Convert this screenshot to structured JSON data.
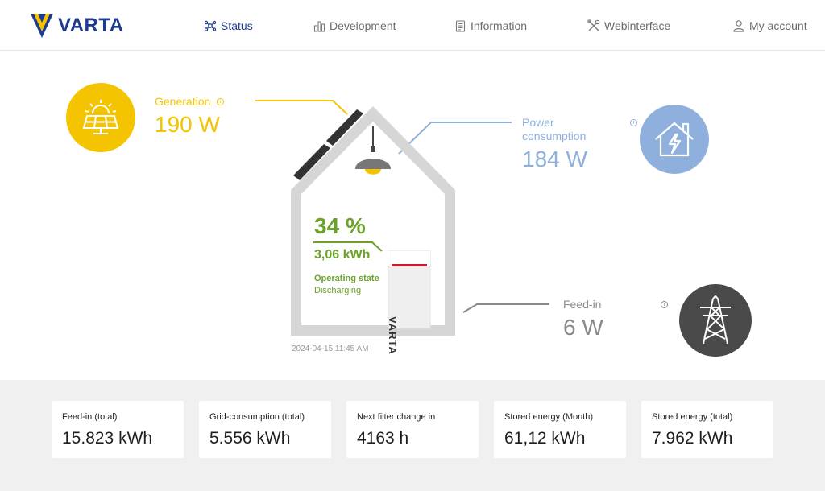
{
  "brand": {
    "name": "VARTA",
    "yellow": "#f9c300",
    "blue": "#1d3c8f"
  },
  "nav": {
    "items": [
      {
        "label": "Status",
        "icon": "network-icon",
        "active": true
      },
      {
        "label": "Development",
        "icon": "bar-chart-icon",
        "active": false
      },
      {
        "label": "Information",
        "icon": "document-icon",
        "active": false
      },
      {
        "label": "Webinterface",
        "icon": "tools-icon",
        "active": false
      },
      {
        "label": "My account",
        "icon": "user-icon",
        "active": false
      }
    ]
  },
  "status": {
    "generation": {
      "label": "Generation",
      "value": "190 W",
      "color": "#f5c400",
      "icon": "solar-panel-icon"
    },
    "consumption": {
      "label_line1": "Power",
      "label_line2": "consumption",
      "value": "184 W",
      "color": "#8fb0dc",
      "icon": "house-icon"
    },
    "feedin": {
      "label": "Feed-in",
      "value": "6 W",
      "color": "#8a8a8a",
      "icon": "power-tower-icon"
    },
    "battery": {
      "percent": "34 %",
      "energy": "3,06 kWh",
      "state_label": "Operating state",
      "state_value": "Discharging",
      "color": "#6ba32a",
      "device_brand": "VARTA"
    },
    "timestamp": "2024-04-15 11:45 AM"
  },
  "stats": [
    {
      "label": "Feed-in (total)",
      "value": "15.823 kWh"
    },
    {
      "label": "Grid-consumption (total)",
      "value": "5.556 kWh"
    },
    {
      "label": "Next filter change in",
      "value": "4163 h"
    },
    {
      "label": "Stored energy (Month)",
      "value": "61,12 kWh"
    },
    {
      "label": "Stored energy (total)",
      "value": "7.962 kWh"
    }
  ]
}
